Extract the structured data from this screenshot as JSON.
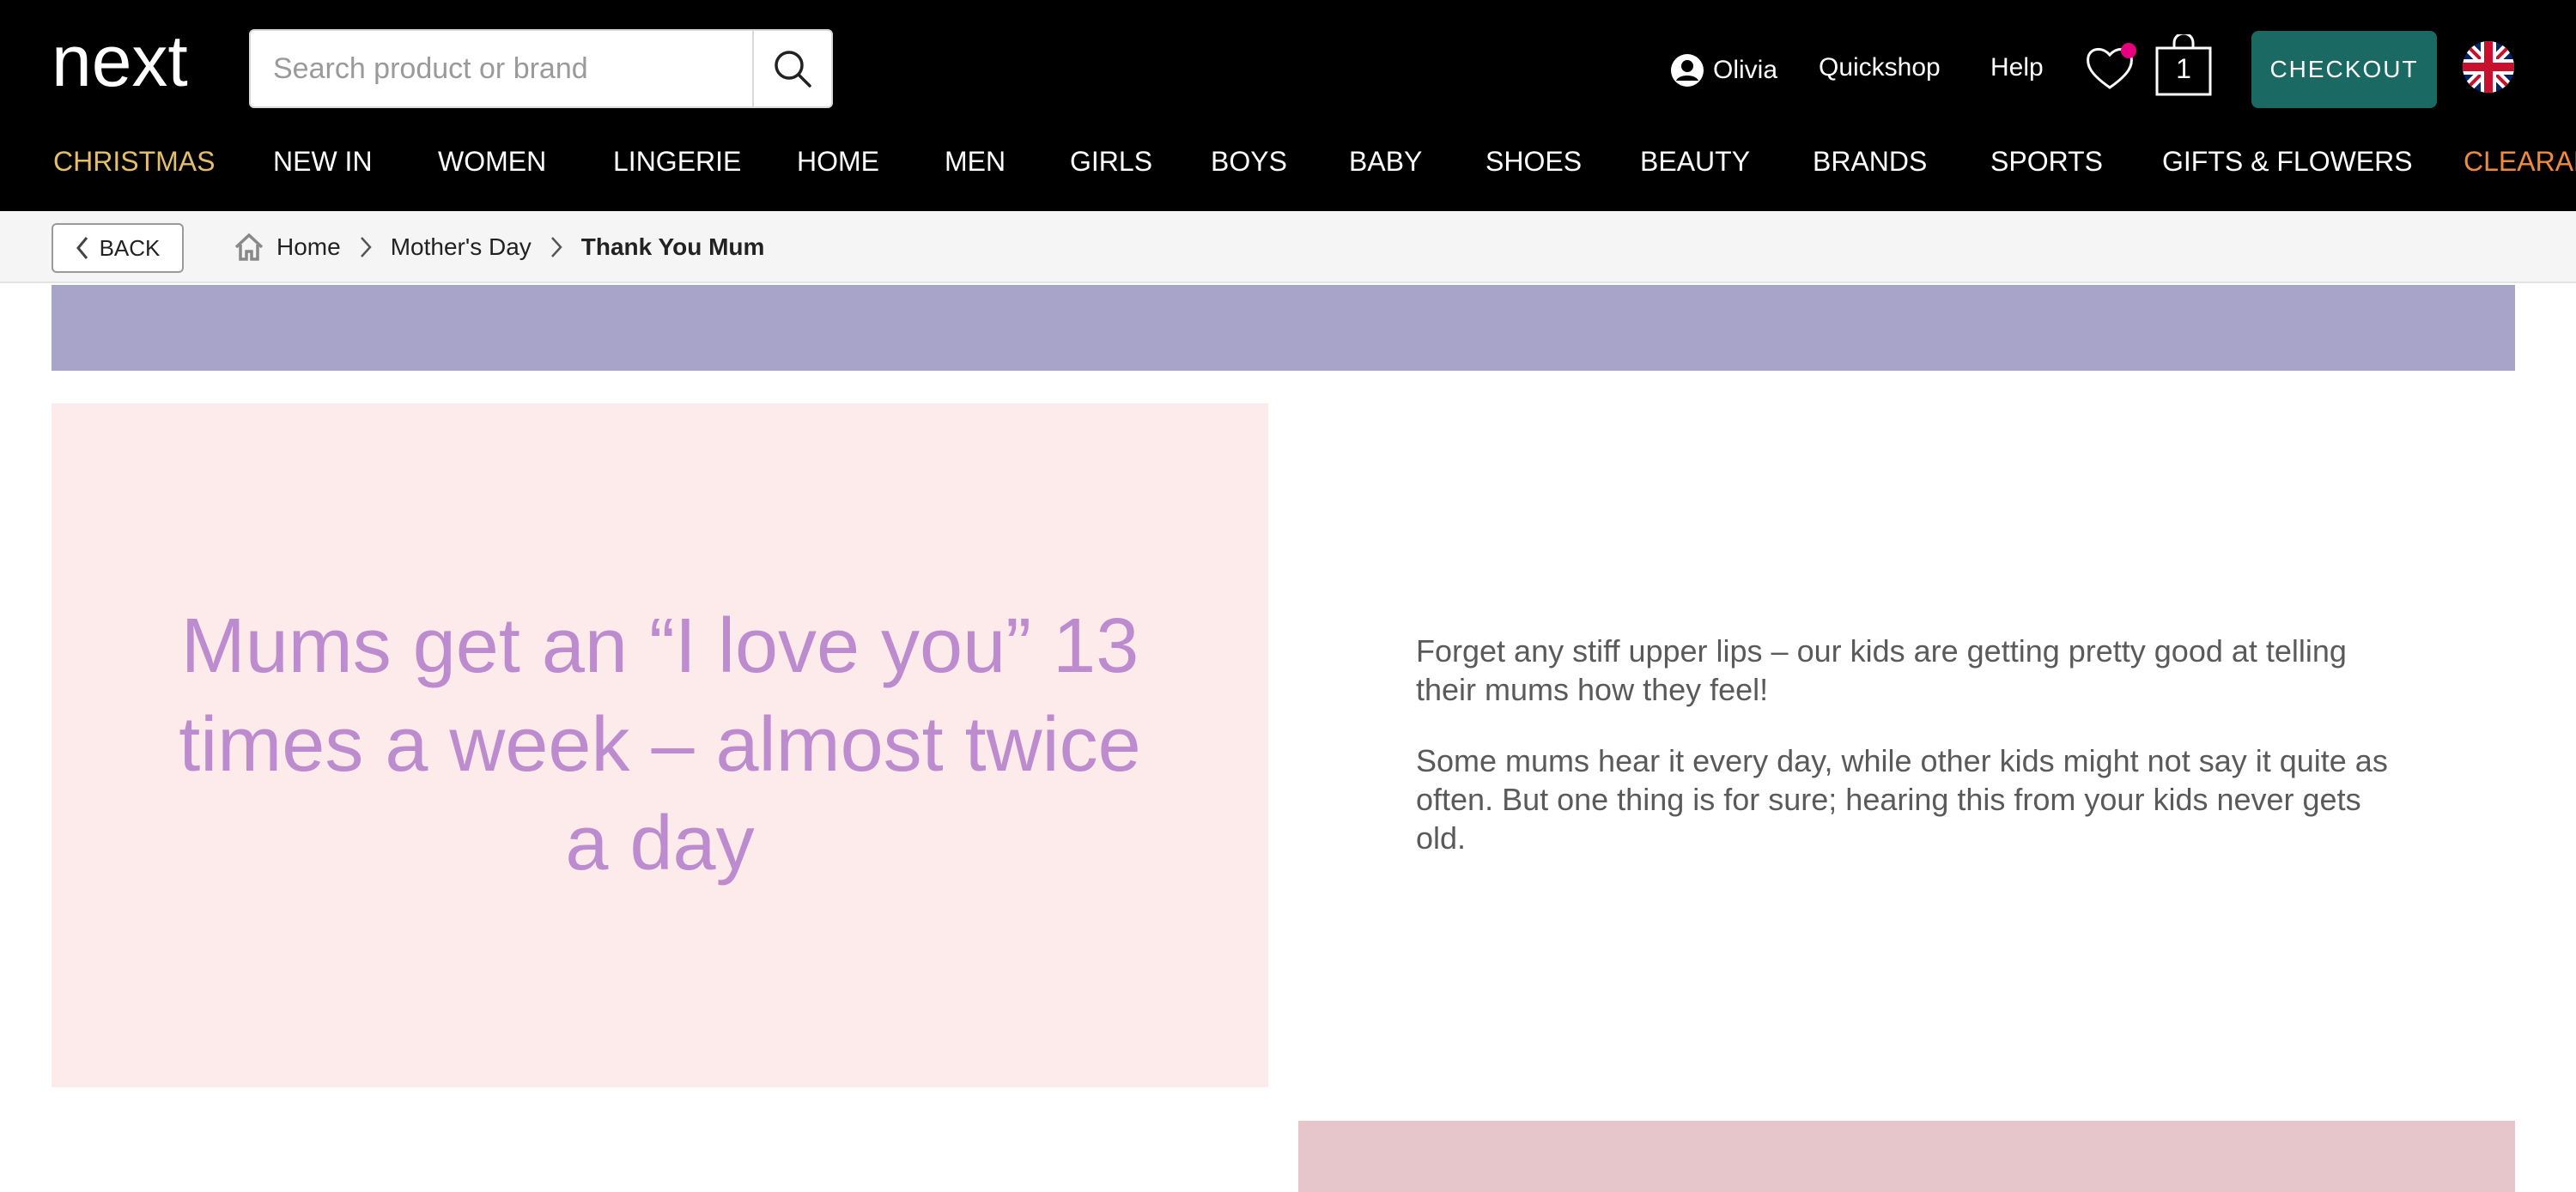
{
  "header": {
    "logo_text": "next",
    "search": {
      "placeholder": "Search product or brand",
      "value": ""
    },
    "account_name": "Olivia",
    "quickshop_label": "Quickshop",
    "help_label": "Help",
    "bag_count": "1",
    "checkout_label": "CHECKOUT",
    "icons": [
      "search-icon",
      "account-icon",
      "heart-icon",
      "bag-icon",
      "uk-flag-icon"
    ],
    "colors": {
      "background": "#000000",
      "checkout": "#1a6a63",
      "wishlist_dot": "#e6007e"
    }
  },
  "nav": {
    "items": [
      {
        "label": "CHRISTMAS",
        "color": "#e3bf6b"
      },
      {
        "label": "NEW IN",
        "color": "#ffffff"
      },
      {
        "label": "WOMEN",
        "color": "#ffffff"
      },
      {
        "label": "LINGERIE",
        "color": "#ffffff"
      },
      {
        "label": "HOME",
        "color": "#ffffff"
      },
      {
        "label": "MEN",
        "color": "#ffffff"
      },
      {
        "label": "GIRLS",
        "color": "#ffffff"
      },
      {
        "label": "BOYS",
        "color": "#ffffff"
      },
      {
        "label": "BABY",
        "color": "#ffffff"
      },
      {
        "label": "SHOES",
        "color": "#ffffff"
      },
      {
        "label": "BEAUTY",
        "color": "#ffffff"
      },
      {
        "label": "BRANDS",
        "color": "#ffffff"
      },
      {
        "label": "SPORTS",
        "color": "#ffffff"
      },
      {
        "label": "GIFTS & FLOWERS",
        "color": "#ffffff"
      },
      {
        "label": "CLEARAN",
        "color": "#f08a3c"
      }
    ]
  },
  "breadcrumb": {
    "back_label": "BACK",
    "items": [
      "Home",
      "Mother's Day",
      "Thank You Mum"
    ]
  },
  "content": {
    "quote": "Mums get an “I love you” 13 times a week – almost twice a day",
    "paragraphs": [
      "Forget any stiff upper lips – our kids are getting pretty good at telling their mums how they feel!",
      "Some mums hear it every day, while other kids might not say it quite as often. But one thing is for sure; hearing this from your kids never gets old."
    ],
    "colors": {
      "banner": "#a8a3c9",
      "quote_panel": "#fdebeb",
      "quote_text": "#bd8cce",
      "bottom_block": "#e6c5cb"
    }
  }
}
